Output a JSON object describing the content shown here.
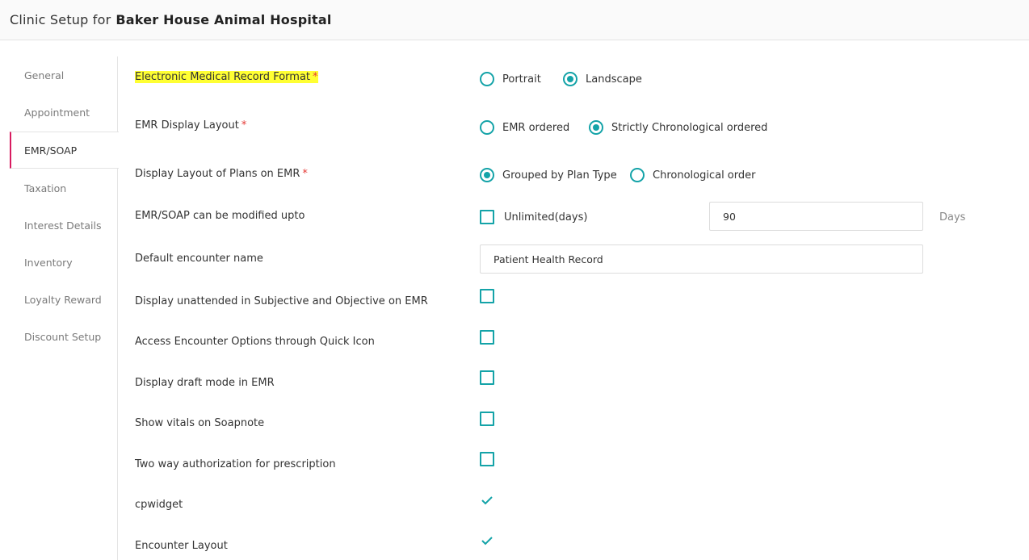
{
  "header": {
    "prefix": "Clinic Setup for",
    "clinic_name": "Baker House Animal Hospital"
  },
  "sidebar": {
    "items": [
      {
        "label": "General"
      },
      {
        "label": "Appointment"
      },
      {
        "label": "EMR/SOAP",
        "active": true
      },
      {
        "label": "Taxation"
      },
      {
        "label": "Interest Details"
      },
      {
        "label": "Inventory"
      },
      {
        "label": "Loyalty Reward"
      },
      {
        "label": "Discount Setup"
      }
    ]
  },
  "form": {
    "emr_format": {
      "label": "Electronic Medical Record Format",
      "required_mark": "*",
      "options": [
        "Portrait",
        "Landscape"
      ],
      "selected": "Landscape"
    },
    "emr_display_layout": {
      "label": "EMR Display Layout",
      "required_mark": "*",
      "options": [
        "EMR ordered",
        "Strictly Chronological ordered"
      ],
      "selected": "Strictly Chronological ordered"
    },
    "plans_layout": {
      "label": "Display Layout of Plans on EMR",
      "required_mark": "*",
      "options": [
        "Grouped by Plan Type",
        "Chronological order"
      ],
      "selected": "Grouped by Plan Type"
    },
    "modify_upto": {
      "label": "EMR/SOAP can be modified upto",
      "unlimited_label": "Unlimited(days)",
      "unlimited_checked": false,
      "value": "90",
      "unit": "Days"
    },
    "encounter_name": {
      "label": "Default encounter name",
      "value": "Patient Health Record"
    },
    "toggles": [
      {
        "label": "Display unattended in Subjective and Objective on EMR",
        "checked": false
      },
      {
        "label": "Access Encounter Options through Quick Icon",
        "checked": false
      },
      {
        "label": "Display draft mode in EMR",
        "checked": false
      },
      {
        "label": "Show vitals on Soapnote",
        "checked": false
      },
      {
        "label": "Two way authorization for prescription",
        "checked": false
      },
      {
        "label": "cpwidget",
        "checked": true
      },
      {
        "label": "Encounter Layout",
        "checked": true
      }
    ]
  },
  "colors": {
    "accent": "#14a3a8",
    "active_marker": "#d81b60",
    "required": "#e53935",
    "highlight": "#ffff33"
  }
}
